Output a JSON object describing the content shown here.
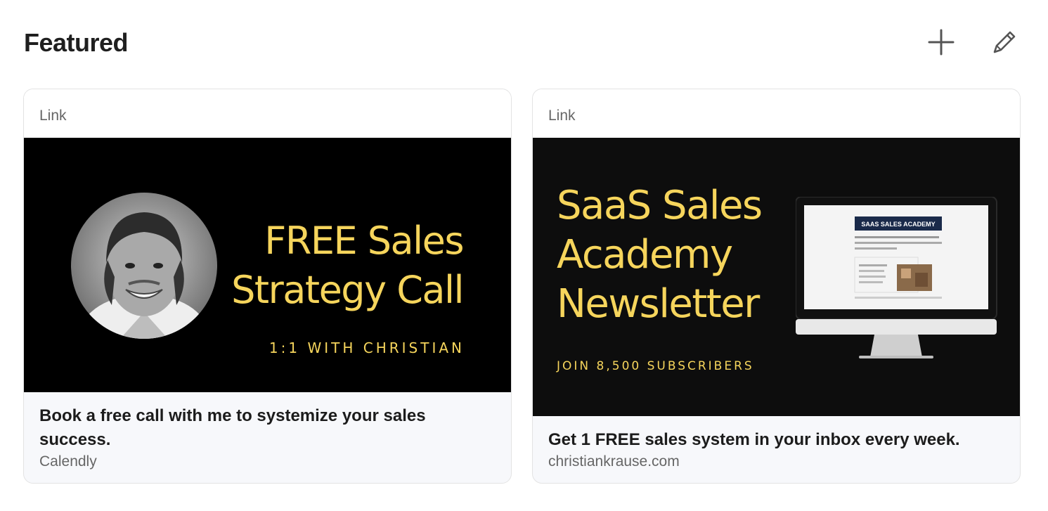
{
  "section": {
    "title": "Featured"
  },
  "cards": [
    {
      "type": "Link",
      "image_headline_line1": "FREE Sales",
      "image_headline_line2": "Strategy Call",
      "image_subline": "1:1 WITH CHRISTIAN",
      "description": "Book a free call with me to systemize your sales success.",
      "source": "Calendly"
    },
    {
      "type": "Link",
      "image_headline_line1": "SaaS Sales",
      "image_headline_line2": "Academy",
      "image_headline_line3": "Newsletter",
      "image_subline": "JOIN 8,500 SUBSCRIBERS",
      "screen_brand": "SAAS SALES ACADEMY",
      "description": "Get 1 FREE sales system in your inbox every week.",
      "source": "christiankrause.com"
    }
  ],
  "icons": {
    "add": "plus-icon",
    "edit": "pencil-icon"
  },
  "colors": {
    "accent": "#f6d55c",
    "card_bg": "#f7f8fb",
    "image_bg": "#000000"
  }
}
